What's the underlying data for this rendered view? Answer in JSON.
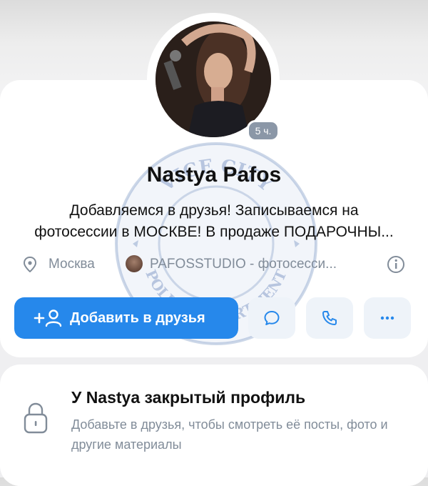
{
  "profile": {
    "story_time": "5 ч.",
    "name": "Nastya Pafos",
    "status": "Добавляемся в друзья! Записываемся на фотосессии в МОСКВЕ! В продаже ПОДАРОЧНЫ...",
    "city": "Москва",
    "group": "PAFOSSTUDIO - фотосесси...",
    "icons": {
      "location": "location-pin-icon",
      "info": "info-icon"
    }
  },
  "actions": {
    "add_friend_label": "Добавить в друзья",
    "add_friend_icon": "add-user-icon",
    "message_icon": "message-icon",
    "call_icon": "phone-icon",
    "more_icon": "more-icon"
  },
  "private": {
    "title": "У Nastya закрытый профиль",
    "description": "Добавьте в друзья, чтобы смотреть её посты, фото и другие материалы",
    "icon": "lock-icon"
  },
  "watermark": {
    "top_text": "VICE CITY",
    "bottom_text": "POLICE DEPARTMENT"
  },
  "colors": {
    "accent": "#2688eb",
    "secondary_text": "#818c99",
    "button_bg": "#eef3f9"
  }
}
